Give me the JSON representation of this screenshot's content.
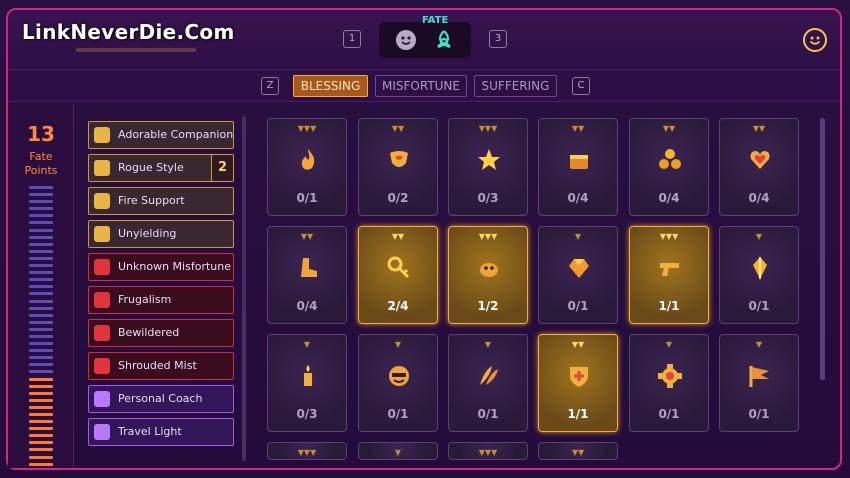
{
  "watermark": "LinkNeverDie.Com",
  "header": {
    "fate_label": "FATE",
    "key_left": "1",
    "key_right": "3",
    "face_icon": "face-icon",
    "fate_icon": "triquetra-icon",
    "smile_icon": "smile-icon"
  },
  "tabs": {
    "key_left": "Z",
    "key_right": "C",
    "items": [
      {
        "label": "BLESSING",
        "active": true
      },
      {
        "label": "MISFORTUNE",
        "active": false
      },
      {
        "label": "SUFFERING",
        "active": false
      }
    ]
  },
  "fate_points": {
    "value": "13",
    "label_line1": "Fate",
    "label_line2": "Points",
    "meter_total": 40,
    "meter_filled": 13
  },
  "list": [
    {
      "label": "Adorable Companion",
      "kind": "gold",
      "icon": "companion-icon"
    },
    {
      "label": "Rogue Style",
      "kind": "gold",
      "icon": "key-icon",
      "count": "2"
    },
    {
      "label": "Fire Support",
      "kind": "gold",
      "icon": "gun-icon"
    },
    {
      "label": "Unyielding",
      "kind": "gold",
      "icon": "shield-icon"
    },
    {
      "label": "Unknown Misfortune",
      "kind": "red",
      "icon": "question-icon"
    },
    {
      "label": "Frugalism",
      "kind": "red",
      "icon": "cross-icon"
    },
    {
      "label": "Bewildered",
      "kind": "red",
      "icon": "question-icon"
    },
    {
      "label": "Shrouded Mist",
      "kind": "red",
      "icon": "question-icon"
    },
    {
      "label": "Personal Coach",
      "kind": "purple",
      "icon": "coach-icon"
    },
    {
      "label": "Travel Light",
      "kind": "purple",
      "icon": "heart-icon"
    }
  ],
  "cards": [
    {
      "progress": "0/1",
      "lit": false,
      "tier": "▼▼▼",
      "icon": "flame-icon"
    },
    {
      "progress": "0/2",
      "lit": false,
      "tier": "▼▼",
      "icon": "heart-shield-icon"
    },
    {
      "progress": "0/3",
      "lit": false,
      "tier": "▼▼▼",
      "icon": "star-icon"
    },
    {
      "progress": "0/4",
      "lit": false,
      "tier": "▼▼",
      "icon": "treasure-icon"
    },
    {
      "progress": "0/4",
      "lit": false,
      "tier": "▼▼",
      "icon": "coins-icon"
    },
    {
      "progress": "0/4",
      "lit": false,
      "tier": "▼▼",
      "icon": "golden-heart-icon"
    },
    {
      "progress": "0/4",
      "lit": false,
      "tier": "▼▼",
      "icon": "boot-icon"
    },
    {
      "progress": "2/4",
      "lit": true,
      "tier": "▼▼",
      "icon": "key-icon"
    },
    {
      "progress": "1/2",
      "lit": true,
      "tier": "▼▼▼",
      "icon": "creature-icon"
    },
    {
      "progress": "0/1",
      "lit": false,
      "tier": "▼",
      "icon": "gem-icon"
    },
    {
      "progress": "1/1",
      "lit": true,
      "tier": "▼▼▼",
      "icon": "gun-icon"
    },
    {
      "progress": "0/1",
      "lit": false,
      "tier": "▼",
      "icon": "crystal-icon"
    },
    {
      "progress": "0/3",
      "lit": false,
      "tier": "▼",
      "icon": "candle-icon"
    },
    {
      "progress": "0/1",
      "lit": false,
      "tier": "▼",
      "icon": "mask-icon"
    },
    {
      "progress": "0/1",
      "lit": false,
      "tier": "▼",
      "icon": "feathers-icon"
    },
    {
      "progress": "1/1",
      "lit": true,
      "tier": "▼▼",
      "icon": "shield-icon"
    },
    {
      "progress": "0/1",
      "lit": false,
      "tier": "▼",
      "icon": "gear-icon"
    },
    {
      "progress": "0/1",
      "lit": false,
      "tier": "▼",
      "icon": "flag-icon"
    },
    {
      "progress": "",
      "lit": false,
      "tier": "▼▼▼",
      "icon": ""
    },
    {
      "progress": "",
      "lit": false,
      "tier": "▼",
      "icon": ""
    },
    {
      "progress": "",
      "lit": false,
      "tier": "▼▼▼",
      "icon": ""
    },
    {
      "progress": "",
      "lit": false,
      "tier": "▼▼",
      "icon": ""
    }
  ],
  "colors": {
    "accent_gold": "#f0b03c",
    "border_pink": "#d4267f",
    "fate_teal": "#3fe2c8",
    "fate_orange": "#ff8a3a"
  }
}
